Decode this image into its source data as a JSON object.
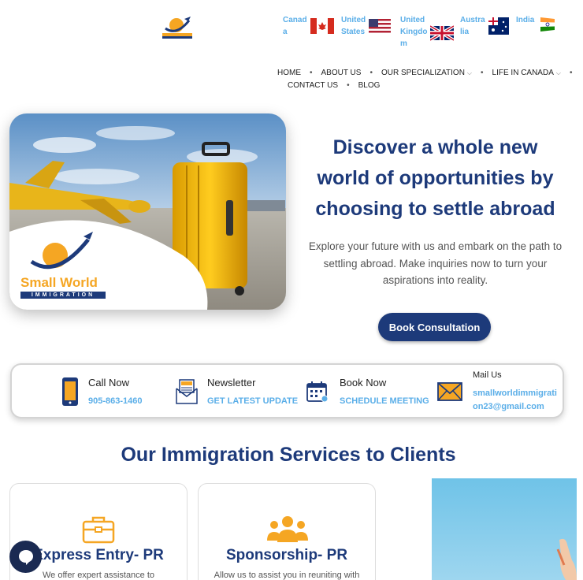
{
  "header": {
    "logo_alt": "Small World Immigration",
    "flags": [
      {
        "label_lines": [
          "Canad",
          "a"
        ],
        "icon": "canada-flag-icon"
      },
      {
        "label_lines": [
          "United",
          "States"
        ],
        "icon": "usa-flag-icon"
      },
      {
        "label_lines": [
          "United",
          "Kingdo",
          "m"
        ],
        "icon": "uk-flag-icon"
      },
      {
        "label_lines": [
          "Austra",
          "lia"
        ],
        "icon": "australia-flag-icon"
      },
      {
        "label_lines": [
          "India"
        ],
        "icon": "india-flag-icon"
      }
    ]
  },
  "nav": {
    "home": "HOME",
    "about": "ABOUT US",
    "specialization": "OUR SPECIALIZATION",
    "life": "LIFE IN CANADA",
    "contact": "CONTACT US",
    "blog": "BLOG"
  },
  "hero": {
    "brand_line1": "Small World",
    "brand_line2": "IMMIGRATION",
    "title": "Discover a whole new world of opportunities by choosing to settle abroad",
    "subtitle": "Explore your future with us and embark on the path to settling abroad. Make inquiries now to turn your aspirations into reality.",
    "cta": "Book Consultation"
  },
  "contact_bar": {
    "call_title": "Call Now",
    "call_value": "905-863-1460",
    "news_title": "Newsletter",
    "news_value": "GET LATEST UPDATE",
    "book_title": "Book Now",
    "book_value": "SCHEDULE MEETING",
    "mail_title": "Mail Us",
    "mail_value_line1": "smallworldimmigrati",
    "mail_value_line2": "on23@gmail.com"
  },
  "services": {
    "title": "Our Immigration Services to Clients",
    "cards": [
      {
        "title": "Express Entry- PR",
        "desc": "We offer expert assistance to"
      },
      {
        "title": "Sponsorship- PR",
        "desc": "Allow us to assist you in reuniting with"
      }
    ]
  },
  "colors": {
    "primary": "#1d3a7a",
    "link": "#5aaee8",
    "accent": "#f5a623"
  }
}
